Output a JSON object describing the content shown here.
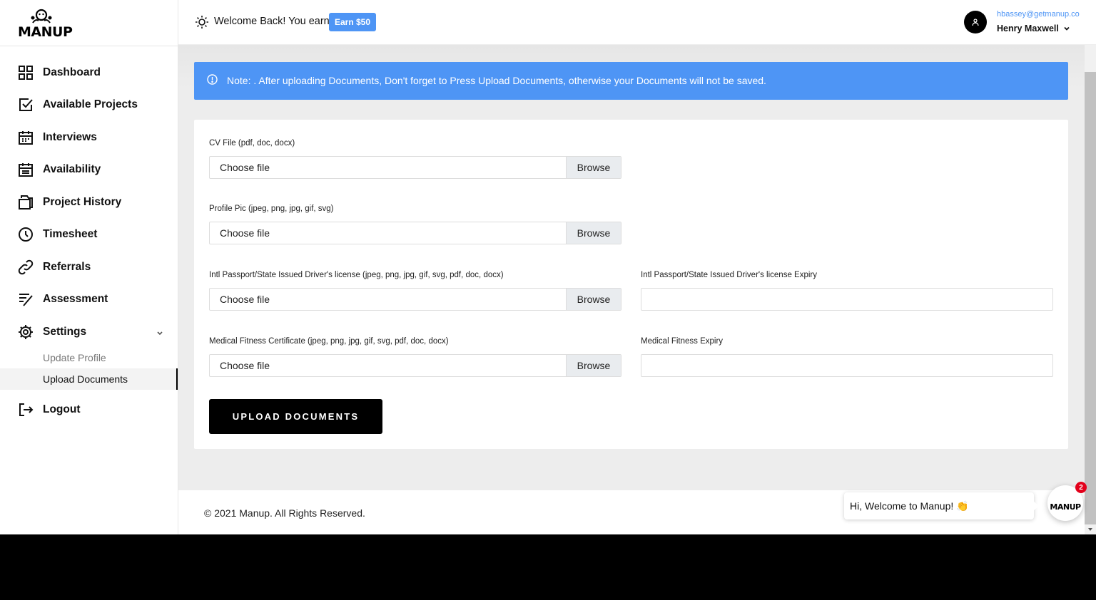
{
  "brand": {
    "name": "MANUP"
  },
  "sidebar": {
    "items": [
      {
        "label": "Dashboard",
        "icon": "grid-icon"
      },
      {
        "label": "Available Projects",
        "icon": "checkbox-icon"
      },
      {
        "label": "Interviews",
        "icon": "calendar-icon"
      },
      {
        "label": "Availability",
        "icon": "calendar-icon"
      },
      {
        "label": "Project History",
        "icon": "folder-icon"
      },
      {
        "label": "Timesheet",
        "icon": "clock-icon"
      },
      {
        "label": "Referrals",
        "icon": "link-icon"
      },
      {
        "label": "Assessment",
        "icon": "list-check-icon"
      },
      {
        "label": "Settings",
        "icon": "gear-icon"
      }
    ],
    "settings_sub": [
      {
        "label": "Update Profile"
      },
      {
        "label": "Upload Documents"
      }
    ],
    "logout": "Logout"
  },
  "header": {
    "welcome": "Welcome Back! You earn:",
    "earn_badge": "Earn $50",
    "user_email": "hbassey@getmanup.co",
    "user_name": "Henry Maxwell"
  },
  "note": {
    "text": "Note: . After uploading Documents, Don't forget to Press Upload Documents, otherwise your Documents will not be saved."
  },
  "form": {
    "choose_label": "Choose file",
    "browse_label": "Browse",
    "cv_label": "CV File (pdf, doc, docx)",
    "profile_pic_label": "Profile Pic (jpeg, png, jpg, gif, svg)",
    "passport_label": "Intl Passport/State Issued Driver's license (jpeg, png, jpg, gif, svg, pdf, doc, docx)",
    "passport_expiry_label": "Intl Passport/State Issued Driver's license Expiry",
    "passport_expiry_value": "",
    "medical_label": "Medical Fitness Certificate (jpeg, png, jpg, gif, svg, pdf, doc, docx)",
    "medical_expiry_label": "Medical Fitness Expiry",
    "medical_expiry_value": "",
    "upload_button": "UPLOAD DOCUMENTS"
  },
  "footer": {
    "copyright": "© 2021 Manup. All Rights Reserved."
  },
  "chat": {
    "greeting": "Hi, Welcome to Manup! 👏",
    "badge_count": "2",
    "launcher_text": "MANUP"
  },
  "colors": {
    "accent": "#4e95f5",
    "primary": "#000000",
    "badge": "#e3001b"
  }
}
